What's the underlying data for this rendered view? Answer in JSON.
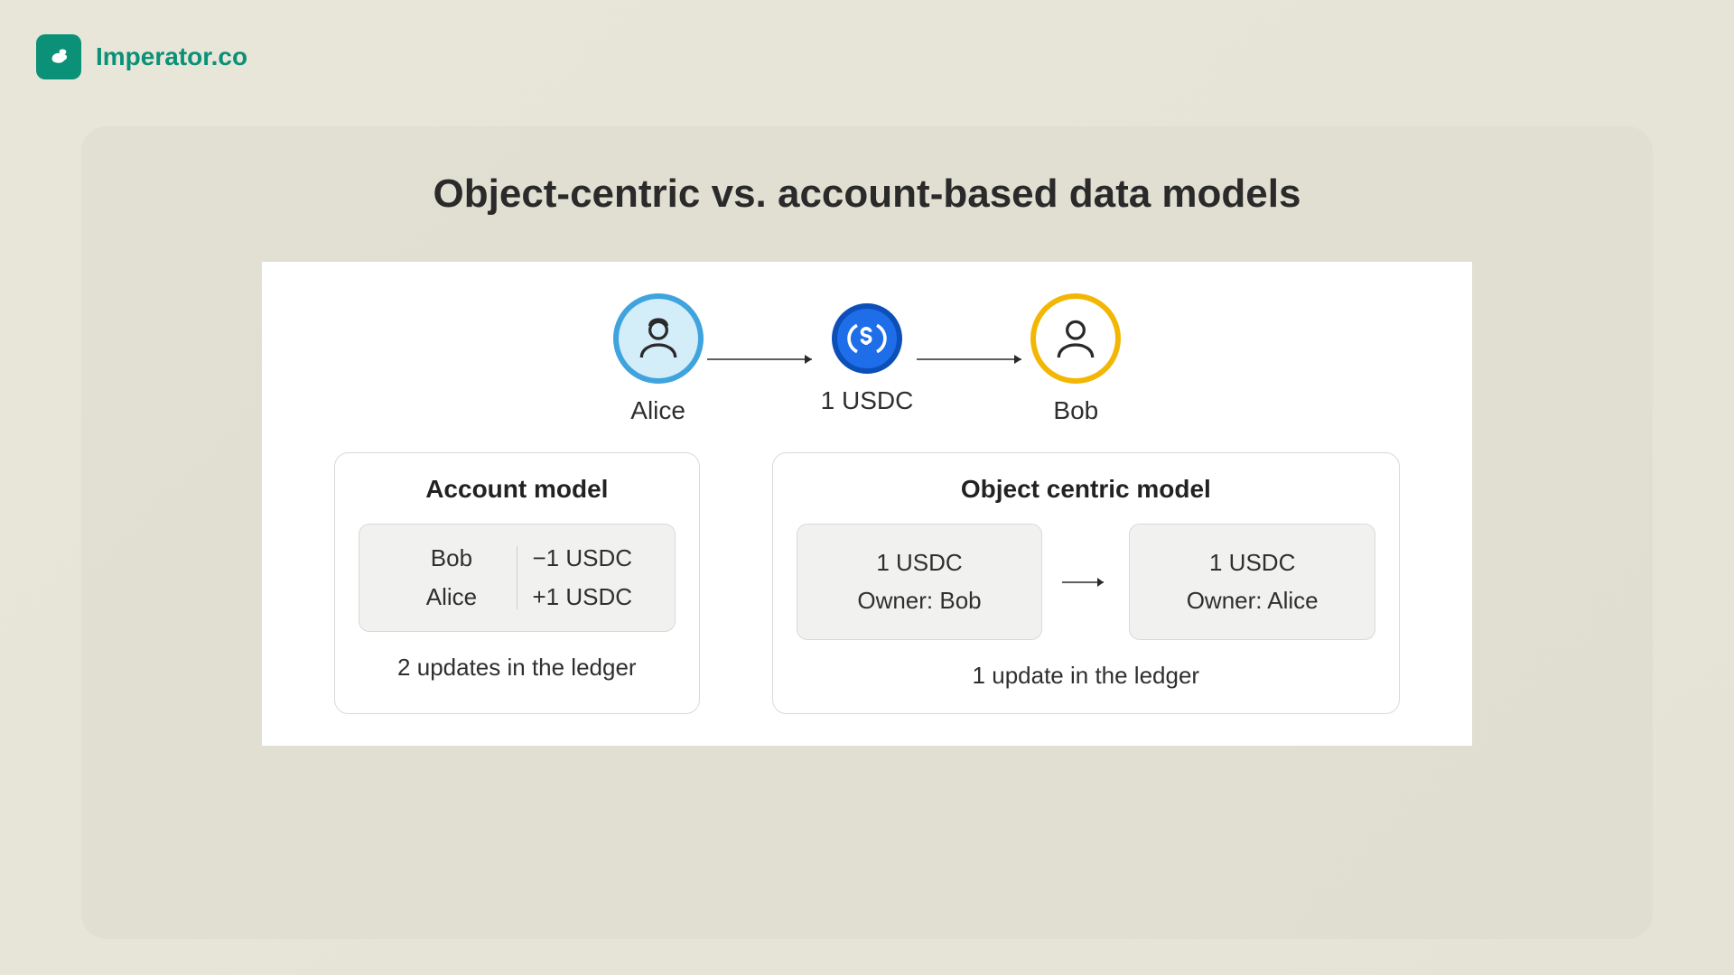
{
  "brand": {
    "name": "Imperator.co"
  },
  "title": "Object-centric vs. account-based data models",
  "flow": {
    "sender": "Alice",
    "asset": "1 USDC",
    "receiver": "Bob"
  },
  "account_model": {
    "title": "Account model",
    "rows": [
      {
        "name": "Bob",
        "delta": "−1 USDC"
      },
      {
        "name": "Alice",
        "delta": "+1 USDC"
      }
    ],
    "summary": "2 updates in the ledger"
  },
  "object_model": {
    "title": "Object centric model",
    "before": {
      "amount": "1 USDC",
      "owner_label": "Owner: Bob"
    },
    "after": {
      "amount": "1 USDC",
      "owner_label": "Owner: Alice"
    },
    "summary": "1 update in the ledger"
  }
}
